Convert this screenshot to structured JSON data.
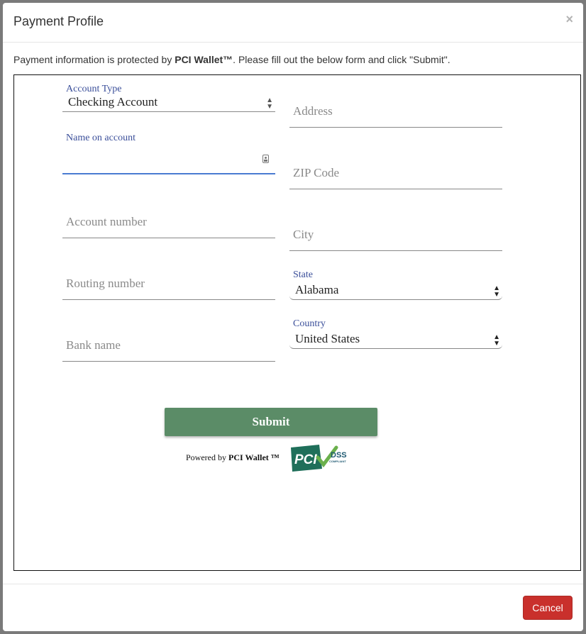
{
  "modal": {
    "title": "Payment Profile",
    "close_label": "×"
  },
  "intro": {
    "prefix": "Payment information is protected by ",
    "brand": "PCI Wallet™",
    "suffix": ". Please fill out the below form and click \"Submit\"."
  },
  "form": {
    "account_type": {
      "label": "Account Type",
      "value": "Checking Account"
    },
    "name_on_account": {
      "label": "Name on account",
      "value": ""
    },
    "account_number": {
      "placeholder": "Account number"
    },
    "routing_number": {
      "placeholder": "Routing number"
    },
    "bank_name": {
      "placeholder": "Bank name"
    },
    "address": {
      "placeholder": "Address"
    },
    "zip_code": {
      "placeholder": "ZIP Code"
    },
    "city": {
      "placeholder": "City"
    },
    "state": {
      "label": "State",
      "value": "Alabama"
    },
    "country": {
      "label": "Country",
      "value": "United States"
    },
    "submit_label": "Submit"
  },
  "footer_brand": {
    "powered_prefix": "Powered by ",
    "powered_brand": "PCI Wallet ™",
    "logo_pci": "PCI",
    "logo_dss": "DSS",
    "logo_compliant": "COMPLIANT"
  },
  "footer": {
    "cancel_label": "Cancel"
  },
  "colors": {
    "submit": "#5b8c67",
    "cancel": "#c9302c",
    "focus": "#4a7bd1",
    "label": "#3b4f9a"
  }
}
